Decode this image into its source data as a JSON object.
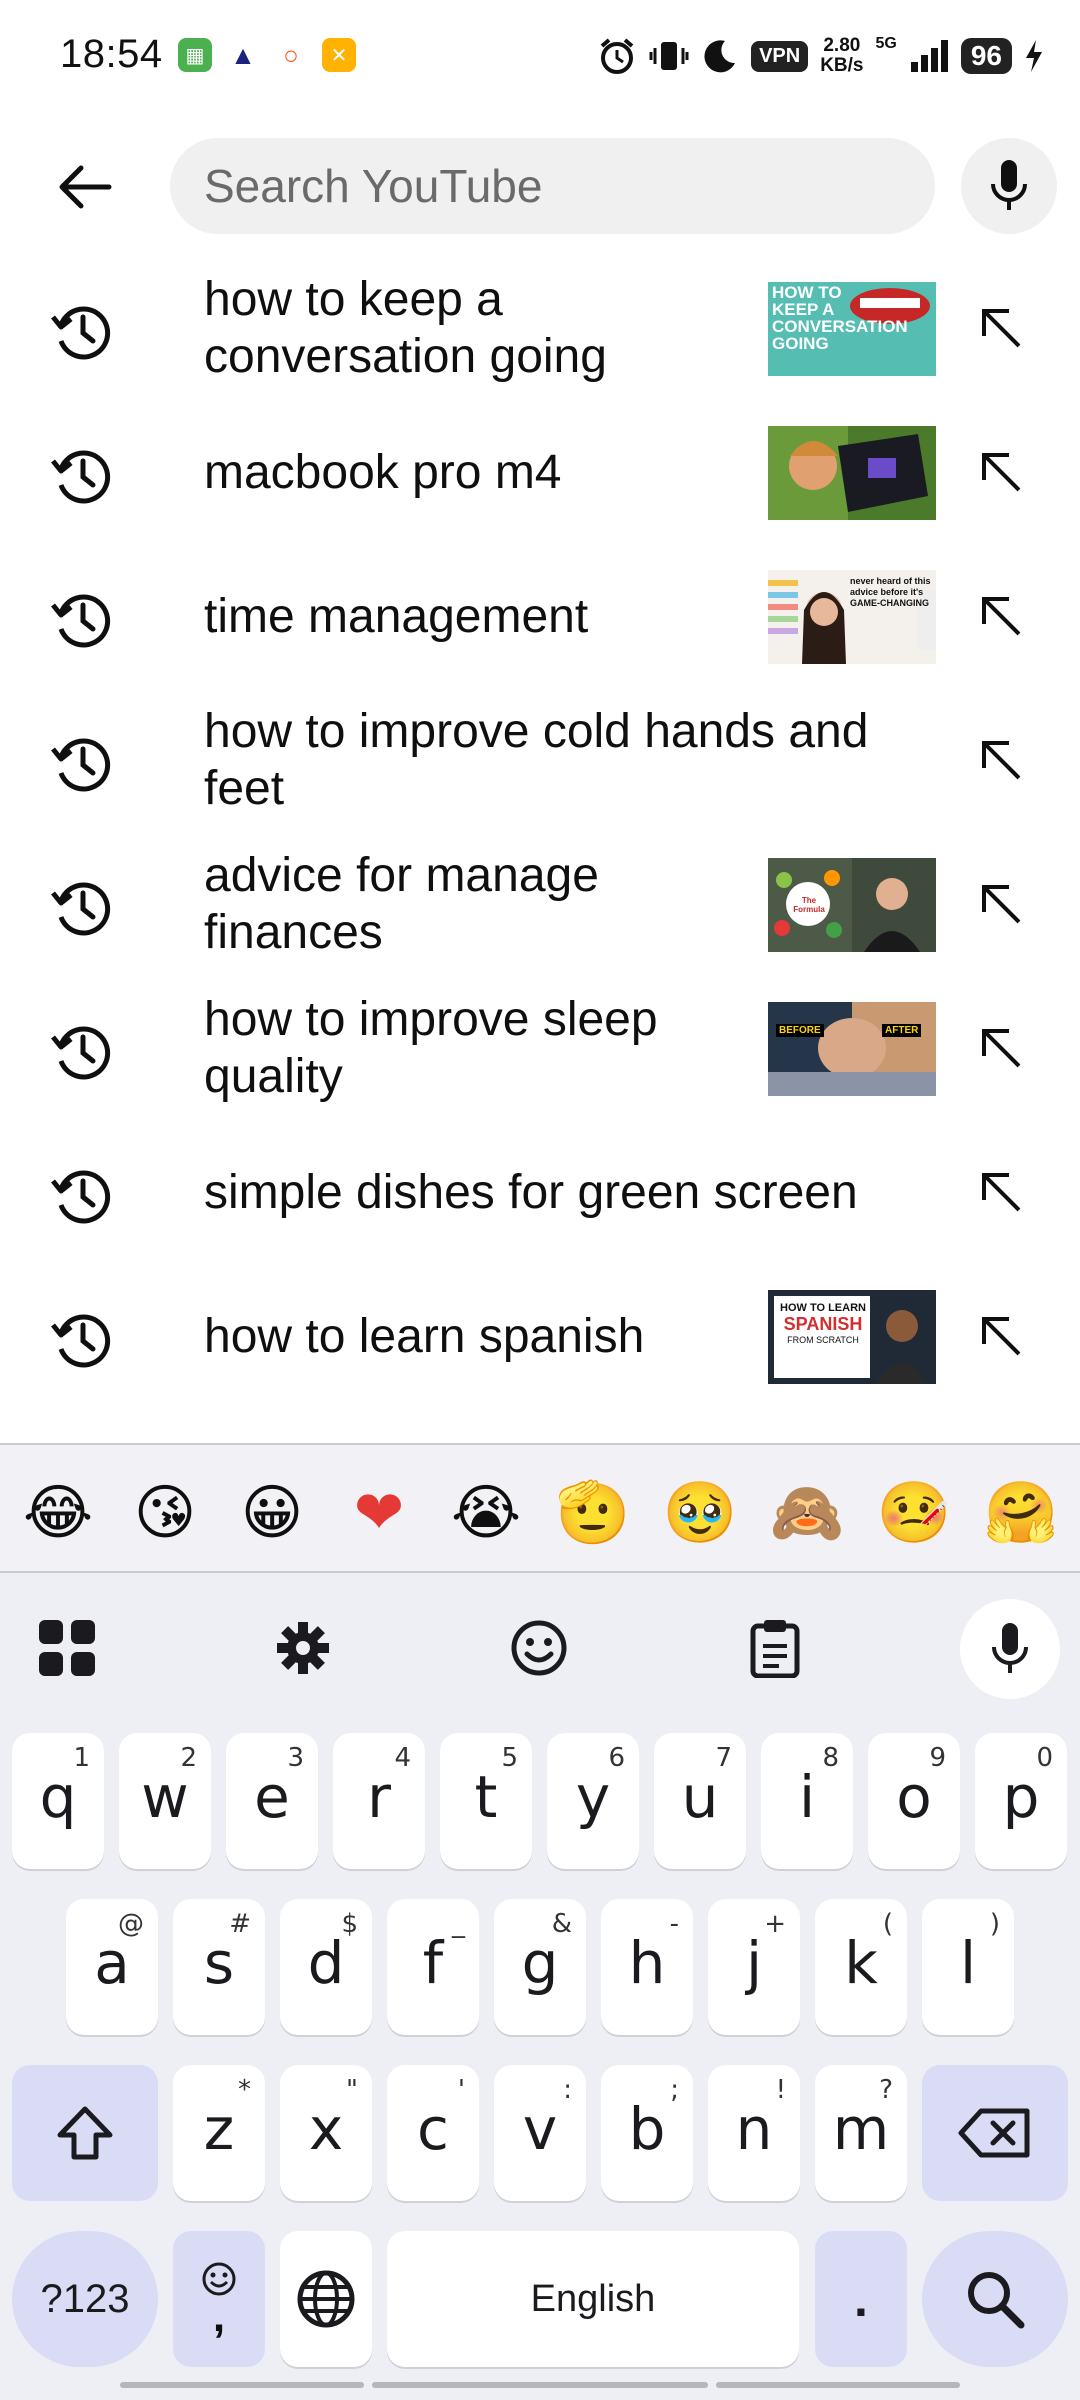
{
  "status_bar": {
    "time": "18:54",
    "vpn": "VPN",
    "speed_value": "2.80",
    "speed_unit": "KB/s",
    "network": "5G",
    "battery": "96"
  },
  "search": {
    "placeholder": "Search YouTube",
    "value": ""
  },
  "suggestions": [
    {
      "text": "how to keep a conversation going",
      "has_thumb": true,
      "thumb_text": "HOW TO KEEP A CONVERSATION GOING"
    },
    {
      "text": "macbook pro m4",
      "has_thumb": true
    },
    {
      "text": "time management",
      "has_thumb": true,
      "thumb_text": "never heard of this advice before it's GAME-CHANGING"
    },
    {
      "text": "how to improve cold hands and feet",
      "has_thumb": false
    },
    {
      "text": "advice for manage finances",
      "has_thumb": true,
      "thumb_text": "The Formula"
    },
    {
      "text": "how to improve sleep quality",
      "has_thumb": true,
      "thumb_before": "BEFORE",
      "thumb_after": "AFTER"
    },
    {
      "text": "simple dishes for green screen",
      "has_thumb": false
    },
    {
      "text": "how to learn spanish",
      "has_thumb": true,
      "thumb_line1": "HOW TO LEARN",
      "thumb_line2": "SPANISH",
      "thumb_line3": "FROM SCRATCH"
    }
  ],
  "keyboard": {
    "emojis": [
      "😂",
      "😘",
      "😀",
      "❤",
      "😭",
      "🫡",
      "🥹",
      "🙈",
      "🤒",
      "🤗"
    ],
    "row1": [
      {
        "k": "q",
        "h": "1"
      },
      {
        "k": "w",
        "h": "2"
      },
      {
        "k": "e",
        "h": "3"
      },
      {
        "k": "r",
        "h": "4"
      },
      {
        "k": "t",
        "h": "5"
      },
      {
        "k": "y",
        "h": "6"
      },
      {
        "k": "u",
        "h": "7"
      },
      {
        "k": "i",
        "h": "8"
      },
      {
        "k": "o",
        "h": "9"
      },
      {
        "k": "p",
        "h": "0"
      }
    ],
    "row2": [
      {
        "k": "a",
        "h": "@"
      },
      {
        "k": "s",
        "h": "#"
      },
      {
        "k": "d",
        "h": "$"
      },
      {
        "k": "f",
        "h": "_"
      },
      {
        "k": "g",
        "h": "&"
      },
      {
        "k": "h",
        "h": "-"
      },
      {
        "k": "j",
        "h": "+"
      },
      {
        "k": "k",
        "h": "("
      },
      {
        "k": "l",
        "h": ")"
      }
    ],
    "row3": [
      {
        "k": "z",
        "h": "*"
      },
      {
        "k": "x",
        "h": "\""
      },
      {
        "k": "c",
        "h": "'"
      },
      {
        "k": "v",
        "h": ":"
      },
      {
        "k": "b",
        "h": ";"
      },
      {
        "k": "n",
        "h": "!"
      },
      {
        "k": "m",
        "h": "?"
      }
    ],
    "symbols_label": "?123",
    "comma_label": ",",
    "space_label": "English",
    "period_label": "."
  }
}
